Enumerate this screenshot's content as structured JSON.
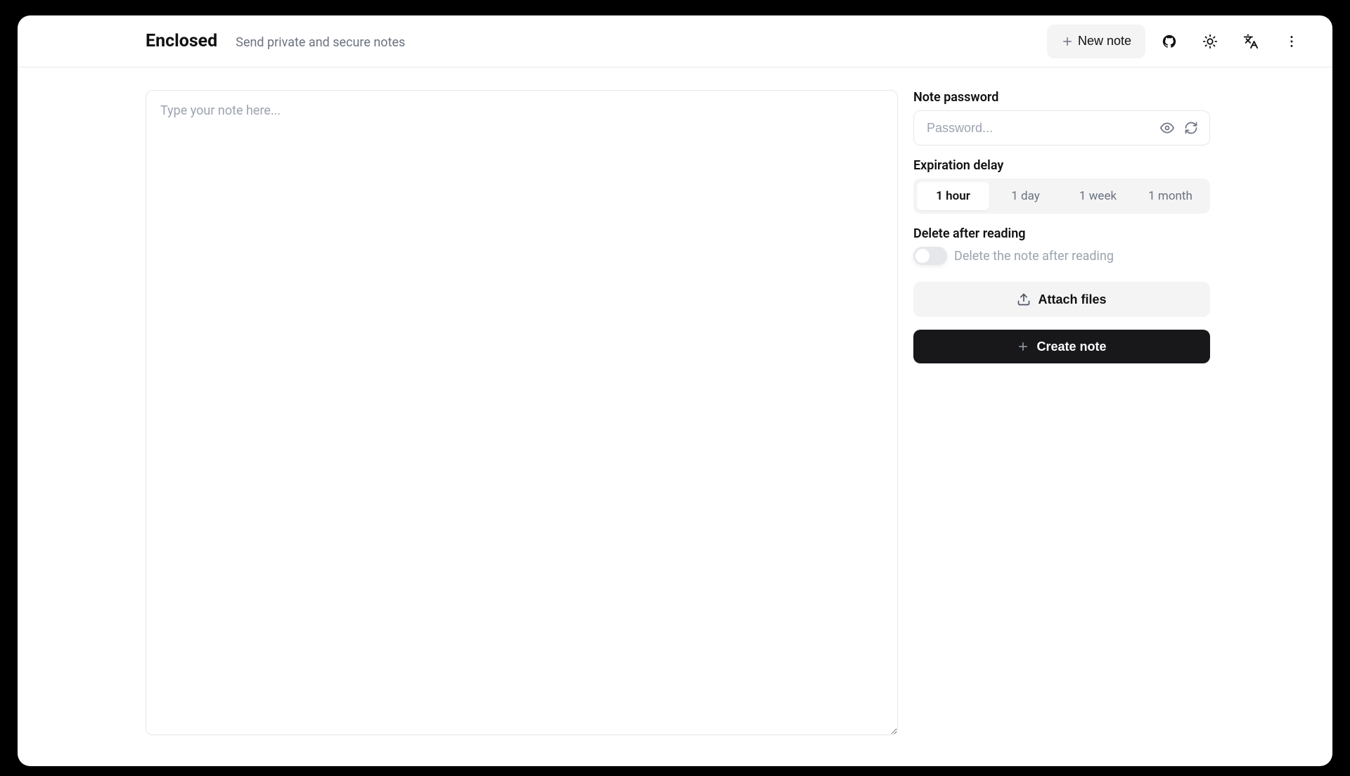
{
  "header": {
    "logo": "Enclosed",
    "tagline": "Send private and secure notes",
    "new_note_label": "New note"
  },
  "editor": {
    "placeholder": "Type your note here..."
  },
  "sidebar": {
    "password": {
      "label": "Note password",
      "placeholder": "Password..."
    },
    "expiration": {
      "label": "Expiration delay",
      "options": [
        "1 hour",
        "1 day",
        "1 week",
        "1 month"
      ],
      "selected": "1 hour"
    },
    "delete_after_reading": {
      "label": "Delete after reading",
      "description": "Delete the note after reading",
      "enabled": false
    },
    "attach_button": "Attach files",
    "create_button": "Create note"
  }
}
